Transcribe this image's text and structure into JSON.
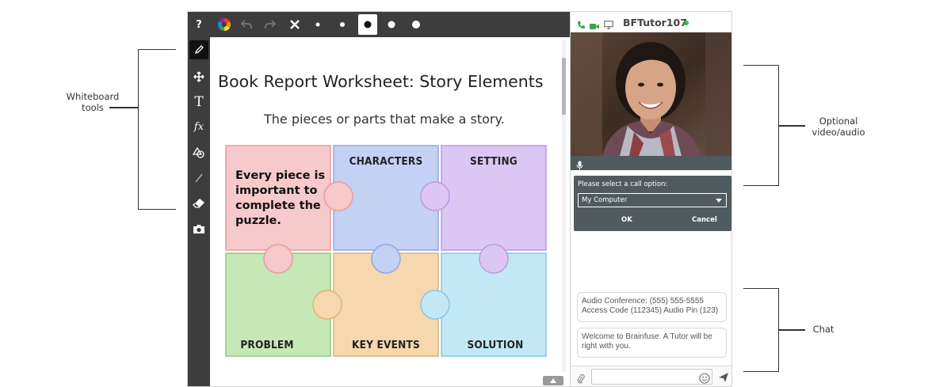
{
  "callouts": {
    "whiteboard_tools": [
      "Whiteboard",
      "tools"
    ],
    "video_audio": [
      "Optional",
      "video/audio"
    ],
    "chat": "Chat"
  },
  "toolbar": {
    "help_label": "?",
    "icons": [
      "help-icon",
      "color-wheel-icon",
      "undo-icon",
      "redo-icon",
      "close-icon",
      "brush-size-1-icon",
      "brush-size-2-icon",
      "brush-size-3-icon",
      "brush-size-4-icon",
      "brush-size-5-icon"
    ]
  },
  "left_tools": [
    "pencil-icon",
    "move-icon",
    "text-icon",
    "formula-icon",
    "shapes-icon",
    "line-icon",
    "eraser-icon",
    "camera-icon"
  ],
  "worksheet": {
    "title": "Book Report Worksheet: Story Elements",
    "subtitle": "The pieces or parts that make a story.",
    "intro": "Every piece is important to complete the puzzle.",
    "pieces": {
      "characters": "CHARACTERS",
      "setting": "SETTING",
      "problem": "PROBLEM",
      "key_events": "KEY EVENTS",
      "solution": "SOLUTION"
    }
  },
  "colors": {
    "pink": "#f6c9cb",
    "blue": "#c2d1f4",
    "purple": "#dcc6f4",
    "green": "#c6e7b6",
    "orange": "#f6d7ae",
    "cyan": "#c2e8f6",
    "toolbar": "#3d3d3d",
    "online": "#2fbf4d"
  },
  "tutor_panel": {
    "tutor_name": "BFTutor107",
    "header_icons": [
      "phone-icon",
      "video-camera-icon",
      "screen-icon"
    ],
    "call_prompt": "Please select a call option:",
    "call_option": "My Computer",
    "ok": "OK",
    "cancel": "Cancel"
  },
  "chat": {
    "messages": [
      "Audio Conference: (555) 555-5555 Access Code (112345) Audio Pin (123)",
      "Welcome to Brainfuse. A Tutor will be right with you."
    ]
  }
}
